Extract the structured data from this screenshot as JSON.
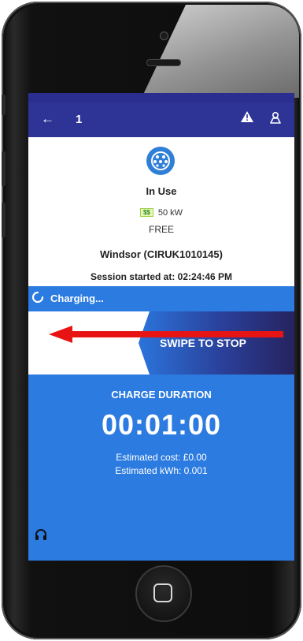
{
  "app_bar": {
    "back_icon": "arrow-left-icon",
    "item_number": "1",
    "warning_icon": "warning-icon",
    "user_icon": "user-icon",
    "color": "#2e3496"
  },
  "status_bar": {
    "text": ""
  },
  "charger": {
    "connector_icon": "type2-connector-icon",
    "status": "In Use",
    "power": "50 kW",
    "power_badge": "$$",
    "price": "FREE",
    "station": "Windsor (CIRUK1010145)",
    "session": "Session started at: 02:24:46 PM"
  },
  "charging": {
    "label": "Charging...",
    "spinner_icon": "loading-spinner-icon",
    "color": "#2c7be0"
  },
  "swipe": {
    "label": "SWIPE TO STOP",
    "arrow_icon": "red-arrow-left-icon"
  },
  "duration": {
    "title": "CHARGE DURATION",
    "time": "00:01:00",
    "estimated_cost": "Estimated cost: £0.00",
    "estimated_kwh": "Estimated kWh: 0.001",
    "support_icon": "headset-icon"
  }
}
